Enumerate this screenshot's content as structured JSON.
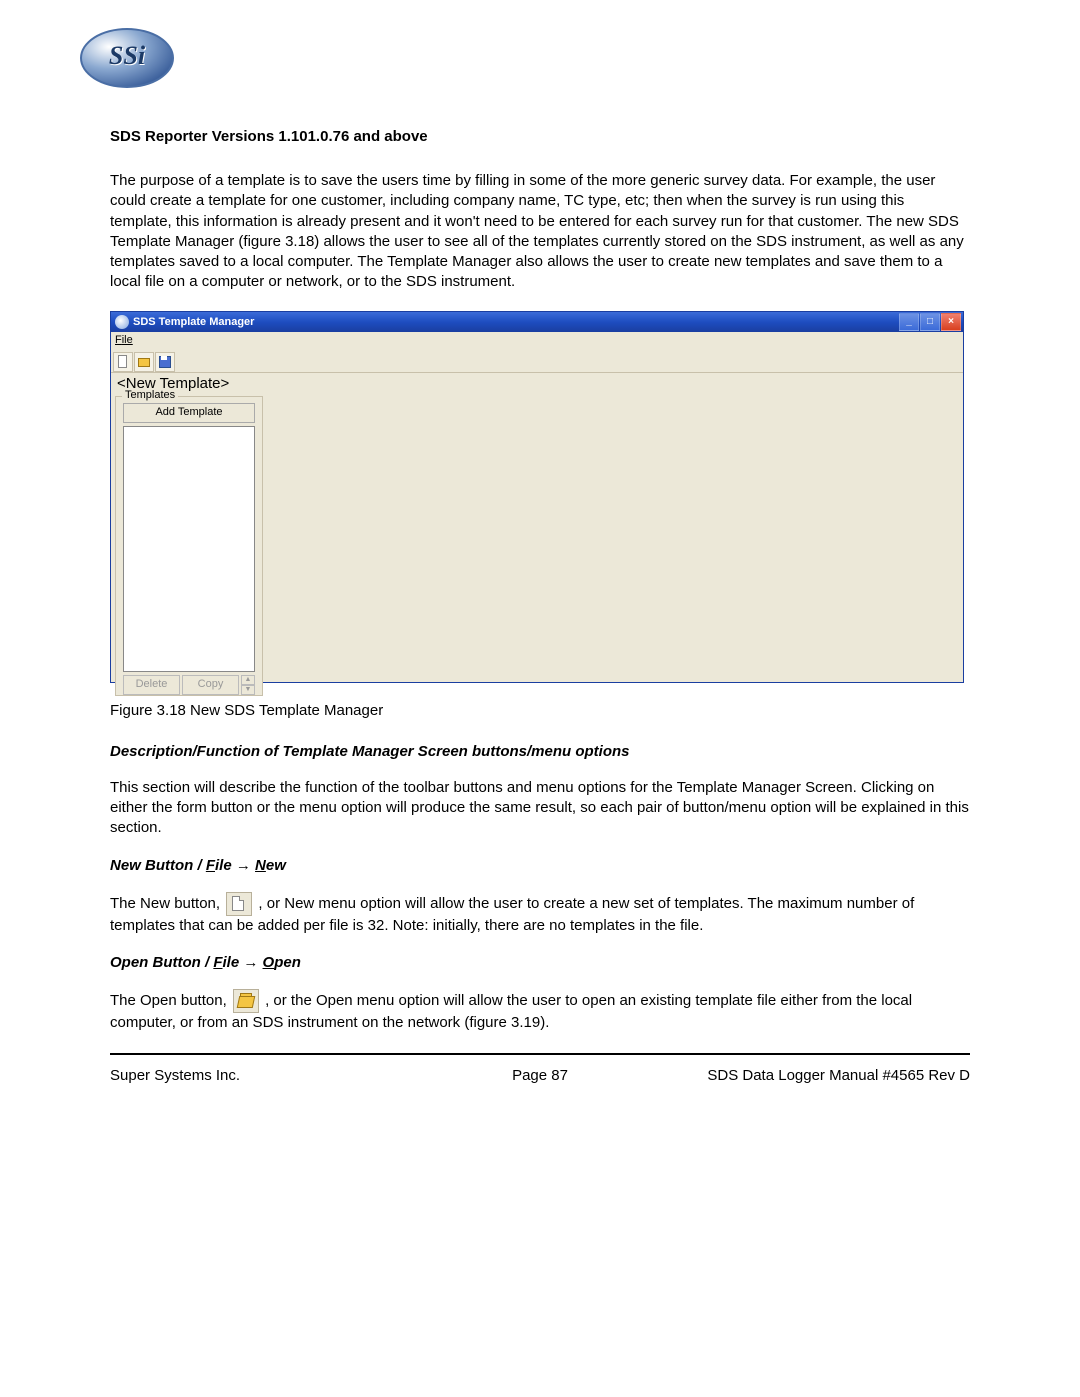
{
  "logo_text": "SSi",
  "heading_version": "SDS Reporter Versions 1.101.0.76 and above",
  "para_intro": "The purpose of a template is to save the users time by filling in some of the more generic survey data. For example, the user could create a template for one customer, including company name, TC type, etc; then when the survey is run using this template, this information is already present and it won't need to be entered for each survey run for that customer.  The new SDS Template Manager (figure 3.18) allows the user to see all of the templates currently stored on the SDS instrument, as well as any templates saved to a local computer.  The Template Manager also allows the user to create new templates and save them to a local file on a computer or network, or to the SDS instrument.",
  "app": {
    "title": "SDS Template Manager",
    "menu_file": "File",
    "template_label": "<New Template>",
    "group_label": "Templates",
    "add_btn": "Add Template",
    "delete_btn": "Delete",
    "copy_btn": "Copy"
  },
  "caption_318": "Figure 3.18 New SDS Template Manager",
  "section_desc_head": "Description/Function of Template Manager Screen buttons/menu options",
  "para_desc": "This section will describe the function of the toolbar buttons and menu options for the Template Manager Screen. Clicking on either the form button or the menu option will produce the same result, so each pair of button/menu option will be explained in this section.",
  "section_new": {
    "pre": "New Button  / ",
    "file": "F",
    "ile": "ile ",
    "arrow": "→ ",
    "n": "N",
    "ew": "ew"
  },
  "para_new_pre": "The New button, ",
  "para_new_post": " , or New menu option will allow the user to create a new set of templates.  The maximum number of templates that can be added per file is 32.  Note: initially, there are no templates in the file.",
  "section_open": {
    "pre": "Open Button / ",
    "file": "F",
    "ile": "ile ",
    "arrow": "→ ",
    "o": "O",
    "pen": "pen"
  },
  "para_open_pre": "The Open button, ",
  "para_open_post": " , or the Open menu option will allow the user to open an existing template file either from the local computer, or from an SDS instrument on the network (figure 3.19).",
  "footer": {
    "left": "Super Systems Inc.",
    "center": "Page 87",
    "right": "SDS Data Logger Manual #4565 Rev D"
  }
}
